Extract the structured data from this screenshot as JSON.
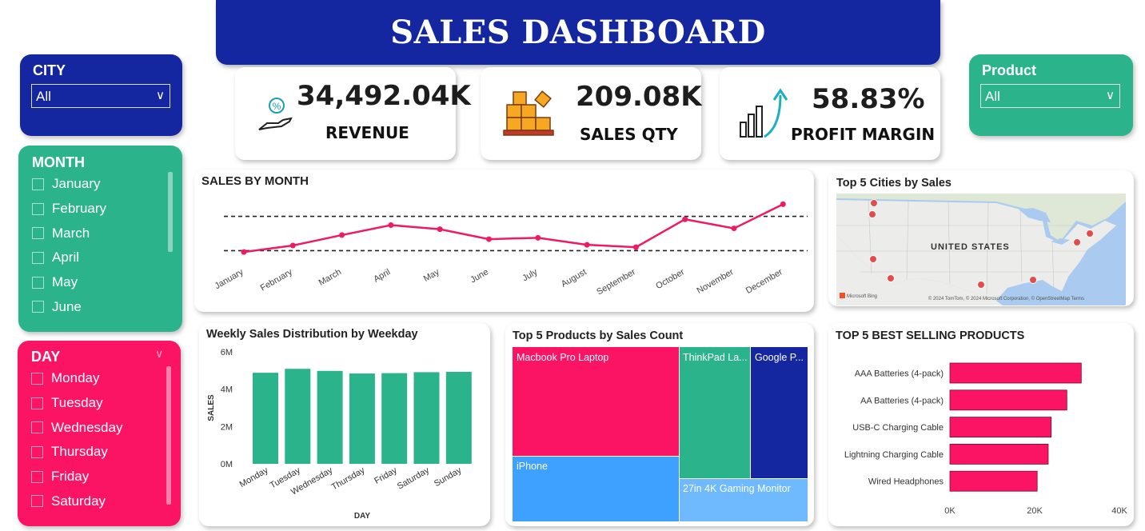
{
  "header": {
    "title": "SALES DASHBOARD"
  },
  "colors": {
    "navy": "#1427a0",
    "green": "#2bb38b",
    "pink": "#fb1463",
    "blue": "#3ea0ff",
    "lightblue": "#6fb9ff"
  },
  "city_slicer": {
    "label": "CITY",
    "value": "All"
  },
  "product_slicer": {
    "label": "Product",
    "value": "All"
  },
  "month_slicer": {
    "label": "MONTH",
    "items": [
      "January",
      "February",
      "March",
      "April",
      "May",
      "June"
    ]
  },
  "day_slicer": {
    "label": "DAY",
    "items": [
      "Monday",
      "Tuesday",
      "Wednesday",
      "Thursday",
      "Friday",
      "Saturday"
    ]
  },
  "kpis": [
    {
      "value": "34,492.04K",
      "label": "REVENUE",
      "icon": "hand-coin-icon"
    },
    {
      "value": "209.08K",
      "label": "SALES QTY",
      "icon": "boxes-icon"
    },
    {
      "value": "58.83%",
      "label": "PROFIT MARGIN",
      "icon": "growth-chart-icon"
    }
  ],
  "map": {
    "title": "Top 5 Cities by Sales",
    "country_label": "UNITED STATES",
    "attribution": "© 2024 TomTom, © 2024 Microsoft Corporation, © OpenStreetMap  Terms",
    "bing": "Microsoft Bing"
  },
  "chart_data": [
    {
      "type": "line",
      "title": "SALES BY MONTH",
      "categories": [
        "January",
        "February",
        "March",
        "April",
        "May",
        "June",
        "July",
        "August",
        "September",
        "October",
        "November",
        "December"
      ],
      "values": [
        1.82,
        2.2,
        2.81,
        3.39,
        3.15,
        2.57,
        2.65,
        2.24,
        2.1,
        3.73,
        3.2,
        4.61
      ],
      "reference_lines": [
        3.9,
        1.9
      ],
      "ylim": [
        1.5,
        5.0
      ]
    },
    {
      "type": "bar",
      "title": "Weekly Sales Distribution by Weekday",
      "categories": [
        "Monday",
        "Tuesday",
        "Wednesday",
        "Thursday",
        "Friday",
        "Saturday",
        "Sunday"
      ],
      "values": [
        4.88,
        5.09,
        4.98,
        4.84,
        4.86,
        4.91,
        4.93
      ],
      "ylabel": "SALES",
      "xlabel": "DAY",
      "yticks": [
        "0M",
        "2M",
        "4M",
        "6M"
      ],
      "ylim": [
        0,
        6
      ]
    },
    {
      "type": "treemap",
      "title": "Top 5 Products by Sales Count",
      "items": [
        {
          "name": "Macbook Pro Laptop",
          "color": "#fb1463"
        },
        {
          "name": "iPhone",
          "color": "#3ea0ff"
        },
        {
          "name": "ThinkPad La...",
          "color": "#2bb38b"
        },
        {
          "name": "27in 4K Gaming Monitor",
          "color": "#6fb9ff"
        },
        {
          "name": "Google P...",
          "color": "#1427a0"
        }
      ]
    },
    {
      "type": "bar",
      "orientation": "horizontal",
      "title": "TOP 5 BEST SELLING PRODUCTS",
      "categories": [
        "AAA Batteries (4-pack)",
        "AA Batteries (4-pack)",
        "USB-C Charging Cable",
        "Lightning Charging Cable",
        "Wired Headphones"
      ],
      "values": [
        31000,
        27600,
        23900,
        23200,
        20600
      ],
      "xticks": [
        "0K",
        "20K",
        "40K"
      ],
      "xlim": [
        0,
        40000
      ]
    }
  ]
}
